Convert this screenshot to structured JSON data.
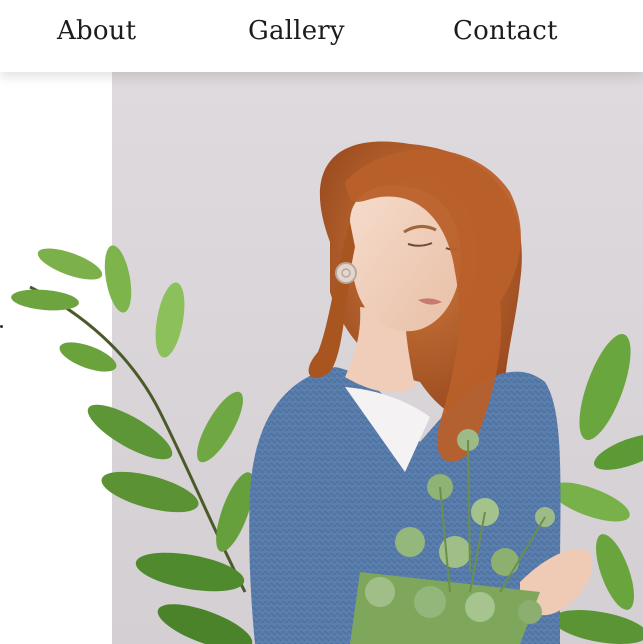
{
  "nav": {
    "links": [
      {
        "label": "About"
      },
      {
        "label": "Gallery"
      },
      {
        "label": "Contact"
      }
    ]
  },
  "hero": {
    "background_color": "#dcd8dc",
    "sweater_color": "#5a7fae",
    "hair_color": "#b8602c",
    "foliage_color": "#5f9a3c"
  }
}
